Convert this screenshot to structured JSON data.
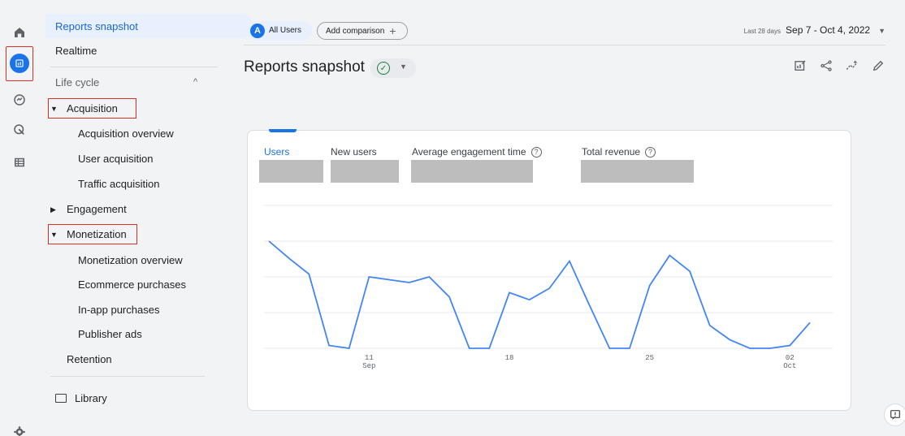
{
  "nav": {
    "selected": "Reports snapshot",
    "realtime": "Realtime",
    "lifecycle": "Life cycle",
    "acquisition": "Acquisition",
    "acquisition_items": [
      "Acquisition overview",
      "User acquisition",
      "Traffic acquisition"
    ],
    "engagement": "Engagement",
    "monetization": "Monetization",
    "monetization_items": [
      "Monetization overview",
      "Ecommerce purchases",
      "In-app purchases",
      "Publisher ads"
    ],
    "retention": "Retention",
    "library": "Library"
  },
  "topbar": {
    "segment_badge": "A",
    "segment": "All Users",
    "add_comparison": "Add comparison",
    "date_label": "Last 28 days",
    "date_range": "Sep 7 - Oct 4, 2022"
  },
  "header": {
    "title": "Reports snapshot"
  },
  "card": {
    "metrics": [
      "Users",
      "New users",
      "Average engagement time",
      "Total revenue"
    ]
  },
  "chart_data": {
    "type": "line",
    "title": "",
    "xlabel": "",
    "ylabel": "",
    "x_ticks": [
      {
        "day": 5,
        "label": "11",
        "sub": "Sep"
      },
      {
        "day": 12,
        "label": "18",
        "sub": ""
      },
      {
        "day": 19,
        "label": "25",
        "sub": ""
      },
      {
        "day": 26,
        "label": "02",
        "sub": "Oct"
      }
    ],
    "series": [
      {
        "values": [
          7.5,
          6.3,
          5.2,
          0.2,
          0.0,
          5.0,
          4.8,
          4.6,
          5.0,
          3.6,
          0.0,
          0.0,
          3.9,
          3.4,
          4.2,
          6.1,
          3.0,
          0.0,
          0.0,
          4.4,
          6.5,
          5.4,
          1.6,
          0.6,
          0.0,
          0.0,
          0.2,
          1.8
        ],
        "color": "#4285f4"
      }
    ],
    "ylim": [
      0,
      10
    ],
    "grid": true
  },
  "colors": {
    "accent": "#1a73e8",
    "line": "#4285f4",
    "highlight": "#d93025"
  }
}
